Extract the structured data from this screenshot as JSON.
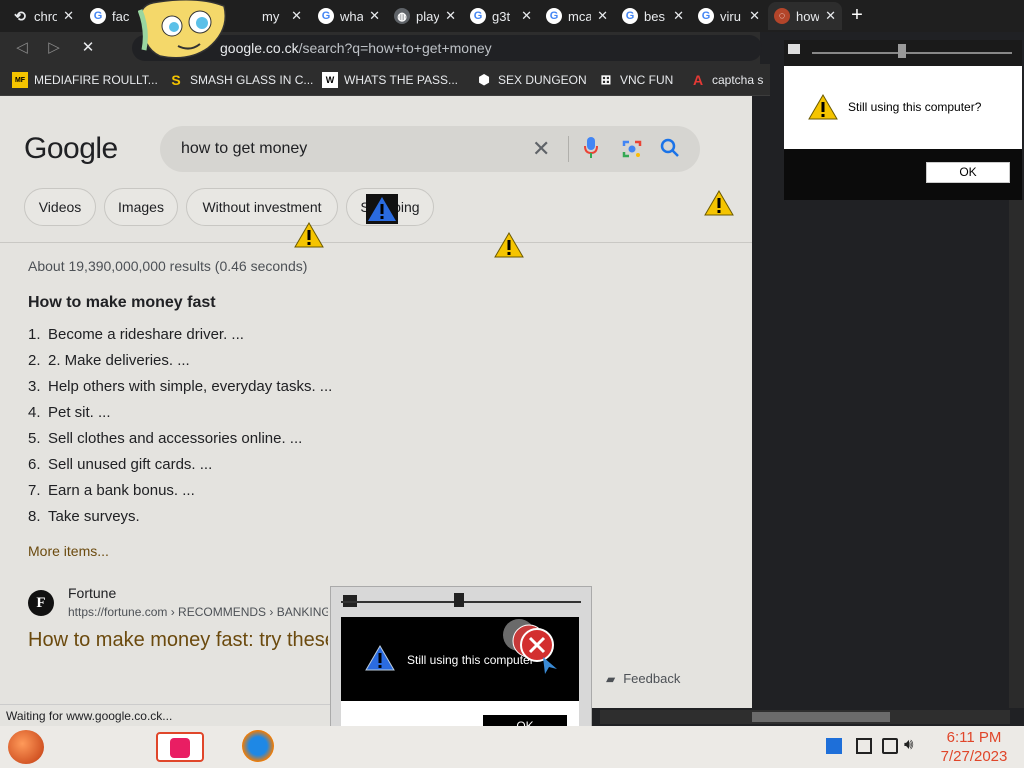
{
  "tabs": [
    {
      "label": "chro",
      "icon": "history-icon"
    },
    {
      "label": "face",
      "icon": "google-icon"
    },
    {
      "label": "my",
      "icon": "globe-icon"
    },
    {
      "label": "wha",
      "icon": "google-icon"
    },
    {
      "label": "play",
      "icon": "globe-icon"
    },
    {
      "label": "g3t",
      "icon": "google-icon"
    },
    {
      "label": "mca",
      "icon": "google-icon"
    },
    {
      "label": "bes",
      "icon": "google-icon"
    },
    {
      "label": "viru",
      "icon": "google-icon"
    },
    {
      "label": "how",
      "icon": "loading-icon"
    }
  ],
  "toolbar": {
    "url_domain": "google.co.ck",
    "url_path": "/search?q=how+to+get+money"
  },
  "bookmarks": [
    {
      "label": "MEDIAFIRE ROULLT...",
      "icon": "MF"
    },
    {
      "label": "SMASH GLASS IN C...",
      "icon": "S"
    },
    {
      "label": "WHATS THE PASS...",
      "icon": "W"
    },
    {
      "label": "SEX DUNGEON",
      "icon": "cube"
    },
    {
      "label": "VNC FUN",
      "icon": "gift"
    },
    {
      "label": "captcha s",
      "icon": "A"
    }
  ],
  "google": {
    "logo": "Google",
    "query": "how to get money",
    "chips": [
      "Videos",
      "Images",
      "Without investment",
      "Shopping"
    ],
    "stats": "About 19,390,000,000 results (0.46 seconds)",
    "snippet_title": "How to make money fast",
    "list": [
      {
        "n": "1.",
        "text": "Become a rideshare driver. ..."
      },
      {
        "n": "2.",
        "text": "2. Make deliveries. ..."
      },
      {
        "n": "3.",
        "text": "Help others with simple, everyday tasks. ..."
      },
      {
        "n": "4.",
        "text": "Pet sit. ..."
      },
      {
        "n": "5.",
        "text": "Sell clothes and accessories online. ..."
      },
      {
        "n": "6.",
        "text": "Sell unused gift cards. ..."
      },
      {
        "n": "7.",
        "text": "Earn a bank bonus. ..."
      },
      {
        "n": "8.",
        "text": "Take surveys."
      }
    ],
    "more_items": "More items...",
    "source_letter": "F",
    "source_name": "Fortune",
    "source_url": "https://fortune.com › RECOMMENDS › BANKING",
    "result_title": "How to make money fast: try these",
    "feedback": "Feedback"
  },
  "status": "Waiting for www.google.co.ck...",
  "dialogs": {
    "top_message": "Still using this computer?",
    "top_ok": "OK",
    "bottom_message": "Still using this computer?",
    "bottom_ok": "OK"
  },
  "clock": {
    "time": "6:11 PM",
    "date": "7/27/2023"
  },
  "colors": {
    "accent_orange": "#e0462a",
    "link_brown": "#6b4a0e",
    "warning_yellow": "#f5c400"
  }
}
